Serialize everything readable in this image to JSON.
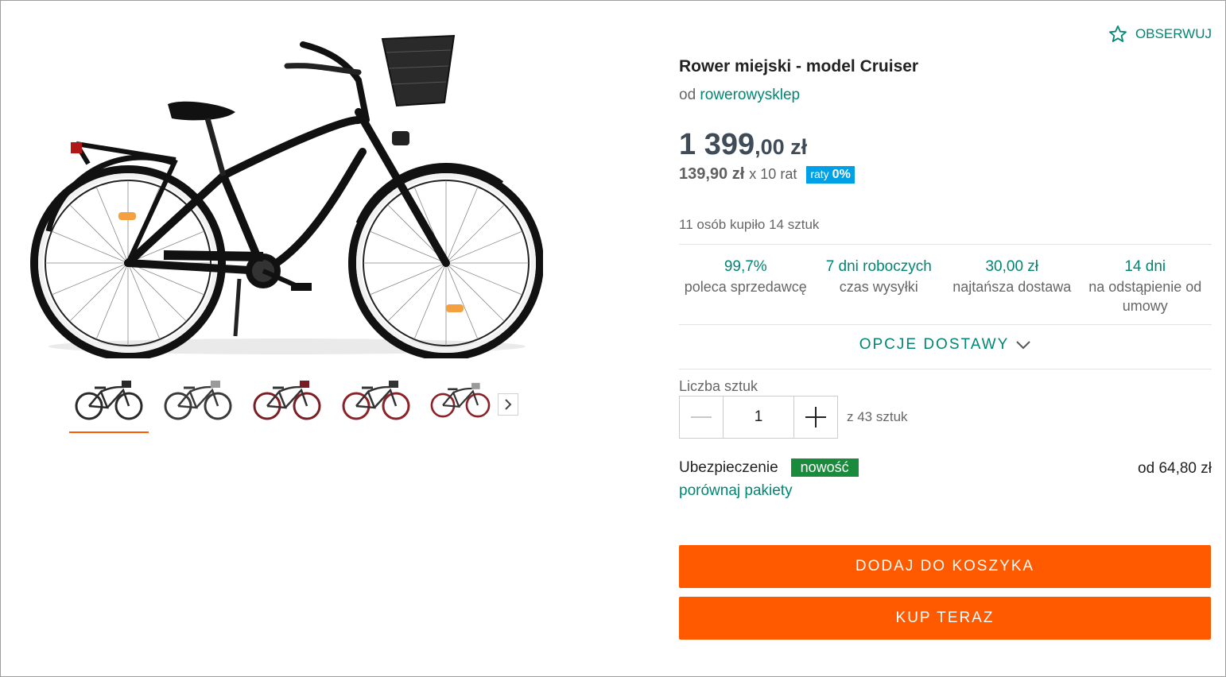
{
  "product": {
    "title": "Rower miejski - model Cruiser",
    "seller_prefix": "od",
    "seller_name": "rowerowysklep",
    "price_main": "1 399",
    "price_cents": ",00 zł",
    "installment_value": "139,90 zł",
    "installment_count": "x 10 rat",
    "raty_label": "raty",
    "raty_rate": "0%",
    "bought_text": "11 osób kupiło 14 sztuk"
  },
  "watch": {
    "label": "OBSERWUJ",
    "icon": "star-outline-icon"
  },
  "stats": [
    {
      "value": "99,7%",
      "label": "poleca sprzedawcę"
    },
    {
      "value": "7 dni roboczych",
      "label": "czas wysyłki"
    },
    {
      "value": "30,00 zł",
      "label": "najtańsza dostawa"
    },
    {
      "value": "14 dni",
      "label": "na odstąpienie od umowy"
    }
  ],
  "delivery_options": {
    "label": "OPCJE DOSTAWY",
    "icon": "chevron-down-icon"
  },
  "quantity": {
    "label": "Liczba sztuk",
    "value": "1",
    "available": "z 43 sztuk"
  },
  "insurance": {
    "label": "Ubezpieczenie",
    "badge": "nowość",
    "price": "od 64,80 zł",
    "compare": "porównaj pakiety"
  },
  "buttons": {
    "add_to_cart": "DODAJ DO KOSZYKA",
    "buy_now": "KUP TERAZ"
  },
  "gallery": {
    "thumbnails": [
      {
        "color": "#2a2a2a",
        "active": true
      },
      {
        "color": "#3a3a3a",
        "active": false
      },
      {
        "color": "#7a1e24",
        "active": false
      },
      {
        "color": "#8a2228",
        "active": false
      },
      {
        "color": "#8a2228",
        "active": false
      }
    ],
    "next_icon": "chevron-right-icon"
  },
  "colors": {
    "accent": "#008673",
    "cta": "#ff5a00",
    "raty_badge": "#00a0e6",
    "new_badge": "#1a8a3c"
  }
}
